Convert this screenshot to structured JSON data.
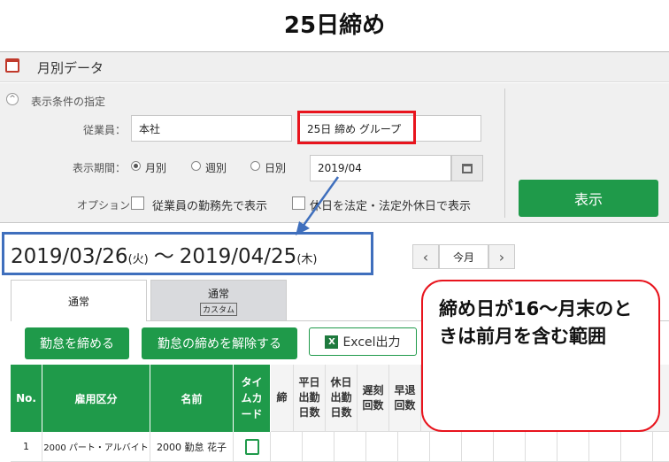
{
  "heading": "25日締め",
  "app": {
    "title": "月別データ"
  },
  "filter": {
    "section_label": "表示条件の指定",
    "employee_label": "従業員：",
    "employee_value": "本社",
    "group_value": "25日 締め グループ",
    "period_label": "表示期間：",
    "period_options": [
      "月別",
      "週別",
      "日別"
    ],
    "period_selected": "月別",
    "date_value": "2019/04",
    "option_label": "オプション：",
    "option1": "従業員の勤務先で表示",
    "option2": "休日を法定・法定外休日で表示",
    "show_button": "表示"
  },
  "range": {
    "start": "2019/03/26",
    "start_day": "(火)",
    "sep": "〜",
    "end": "2019/04/25",
    "end_day": "(木)"
  },
  "nav": {
    "this_month": "今月"
  },
  "tabs": [
    {
      "label": "通常",
      "sub": ""
    },
    {
      "label": "通常",
      "sub": "カスタム"
    }
  ],
  "actions": {
    "close": "勤怠を締める",
    "unclose": "勤怠の締めを解除する",
    "excel": "Excel出力"
  },
  "table": {
    "headers": [
      "No.",
      "雇用区分",
      "名前",
      "タイムカード",
      "締",
      "平日出勤日数",
      "休日出勤日数",
      "遅刻回数",
      "早退回数"
    ],
    "rows": [
      {
        "no": "1",
        "type": "2000 パート・アルバイト",
        "name": "2000 勤怠 花子"
      }
    ]
  },
  "callout": {
    "text": "締め日が16〜月末のときは前月を含む範囲"
  },
  "colors": {
    "green": "#1f9a4a",
    "blue": "#3f6fbd",
    "red": "#e8141d"
  }
}
